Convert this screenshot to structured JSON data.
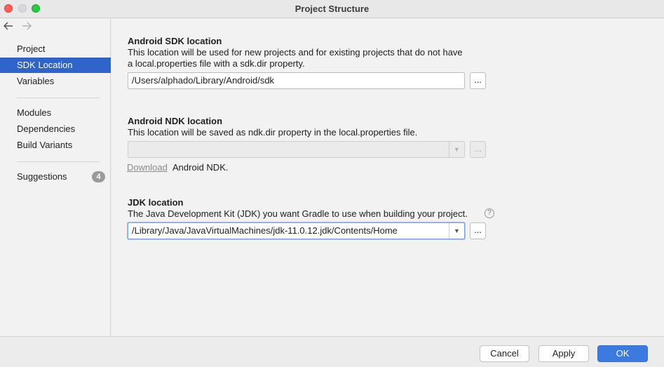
{
  "window": {
    "title": "Project Structure"
  },
  "nav": {
    "back_icon": "arrow-left-icon",
    "forward_icon": "arrow-right-icon"
  },
  "sidebar": {
    "items": [
      {
        "label": "Project",
        "selected": false
      },
      {
        "label": "SDK Location",
        "selected": true
      },
      {
        "label": "Variables",
        "selected": false
      },
      {
        "label": "Modules",
        "selected": false
      },
      {
        "label": "Dependencies",
        "selected": false
      },
      {
        "label": "Build Variants",
        "selected": false
      },
      {
        "label": "Suggestions",
        "selected": false,
        "badge": "4"
      }
    ],
    "selected_color": "#2f65ca"
  },
  "sdk": {
    "heading": "Android SDK location",
    "description_line1": "This location will be used for new projects and for existing projects that do not have",
    "description_line2": "a local.properties file with a sdk.dir property.",
    "path": "/Users/alphado/Library/Android/sdk",
    "browse_label": "..."
  },
  "ndk": {
    "heading": "Android NDK location",
    "description": "This location will be saved as ndk.dir property in the local.properties file.",
    "path": "",
    "browse_label": "...",
    "download_link": "Download",
    "download_suffix": "Android NDK."
  },
  "jdk": {
    "heading": "JDK location",
    "description": "The Java Development Kit (JDK) you want Gradle to use when building your project.",
    "help": "?",
    "path": "/Library/Java/JavaVirtualMachines/jdk-11.0.12.jdk/Contents/Home",
    "browse_label": "..."
  },
  "footer": {
    "cancel_label": "Cancel",
    "apply_label": "Apply",
    "ok_label": "OK"
  },
  "colors": {
    "primary_button": "#3d7ae0",
    "close": "#fe5f57",
    "maximize": "#28c840"
  }
}
